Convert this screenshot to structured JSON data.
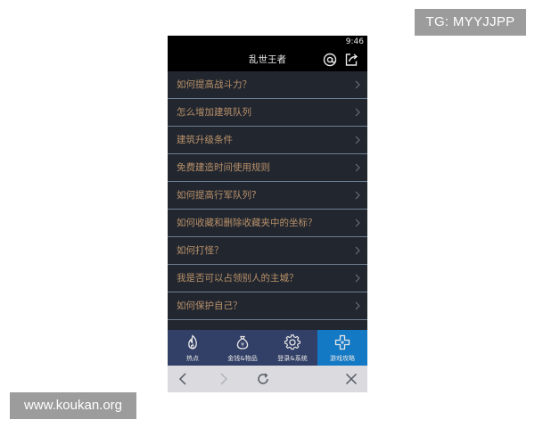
{
  "watermarks": {
    "top_right": "TG: MYYJJPP",
    "bottom_left": "www.koukan.org"
  },
  "status_bar": {
    "time": "9:46"
  },
  "header": {
    "title": "乱世王者",
    "at_icon": "at-sign-icon",
    "share_icon": "share-icon"
  },
  "faq": {
    "items": [
      {
        "label": "如何提高战斗力？"
      },
      {
        "label": "怎么增加建筑队列"
      },
      {
        "label": "建筑升级条件"
      },
      {
        "label": "免费建造时间使用规则"
      },
      {
        "label": "如何提高行军队列?"
      },
      {
        "label": "如何收藏和删除收藏夹中的坐标？"
      },
      {
        "label": "如何打怪？"
      },
      {
        "label": "我是否可以占领别人的主城？"
      },
      {
        "label": "如何保护自己？"
      }
    ]
  },
  "tabs": [
    {
      "label": "热点",
      "icon": "flame-icon",
      "active": false
    },
    {
      "label": "金钱&物品",
      "icon": "money-bag-icon",
      "active": false
    },
    {
      "label": "登录&系统",
      "icon": "gear-icon",
      "active": false
    },
    {
      "label": "游戏攻略",
      "icon": "gamepad-icon",
      "active": true
    }
  ],
  "nav": {
    "back": "chevron-left-icon",
    "forward": "chevron-right-icon",
    "refresh": "refresh-icon",
    "close": "close-icon"
  },
  "colors": {
    "list_bg": "#22262f",
    "item_text": "#b8916a",
    "divider": "#6c7f93",
    "tabbar_bg": "#323f66",
    "tab_active": "#1479c4",
    "navbar_bg": "#dadadf"
  }
}
